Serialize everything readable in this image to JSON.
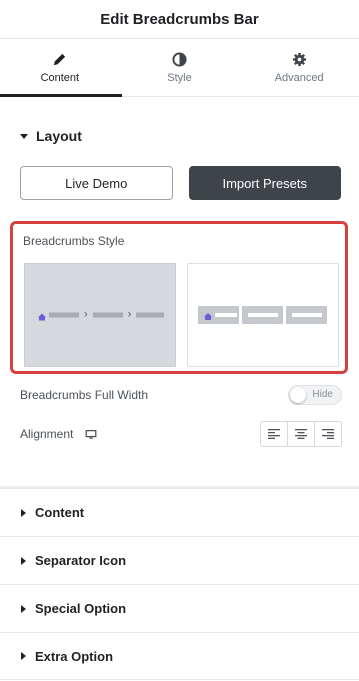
{
  "header": {
    "title": "Edit Breadcrumbs Bar"
  },
  "tabs": [
    {
      "label": "Content",
      "icon": "pencil-icon",
      "active": true
    },
    {
      "label": "Style",
      "icon": "contrast-icon",
      "active": false
    },
    {
      "label": "Advanced",
      "icon": "gear-icon",
      "active": false
    }
  ],
  "layout": {
    "title": "Layout",
    "live_demo_label": "Live Demo",
    "import_presets_label": "Import Presets",
    "breadcrumbs_style_label": "Breadcrumbs Style",
    "full_width": {
      "label": "Breadcrumbs Full Width",
      "toggle_text": "Hide",
      "enabled": false
    },
    "alignment": {
      "label": "Alignment",
      "device_icon": "desktop-icon",
      "options": [
        "align-left-icon",
        "align-center-icon",
        "align-right-icon"
      ]
    }
  },
  "sections": [
    {
      "label": "Content"
    },
    {
      "label": "Separator Icon"
    },
    {
      "label": "Special Option"
    },
    {
      "label": "Extra Option"
    }
  ],
  "colors": {
    "accent_red": "#d74040",
    "dark_button": "#3e444a",
    "home_icon": "#6f5bd9"
  }
}
